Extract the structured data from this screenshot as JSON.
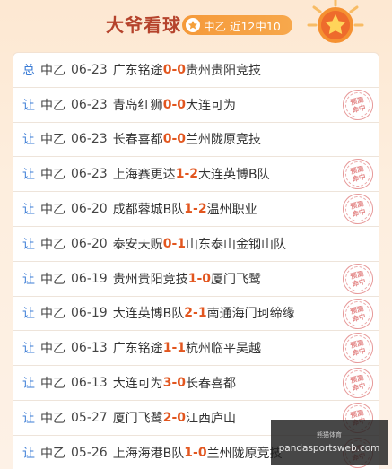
{
  "header": {
    "title": "大爷看球",
    "badge_label": "中乙 近12中10"
  },
  "rows": [
    {
      "kind": "总",
      "league": "中乙",
      "date": "06-23",
      "home": "广东铭途",
      "home_score": "0",
      "sep": " - ",
      "away_score": "0",
      "away": "贵州贵阳竞技",
      "hit": false
    },
    {
      "kind": "让",
      "league": "中乙",
      "date": "06-23",
      "home": "青岛红狮",
      "home_score": "0",
      "sep": " - ",
      "away_score": "0",
      "away": "大连可为",
      "hit": true
    },
    {
      "kind": "让",
      "league": "中乙",
      "date": "06-23",
      "home": "长春喜都",
      "home_score": "0",
      "sep": " - ",
      "away_score": "0",
      "away": "兰州陇原竞技",
      "hit": false
    },
    {
      "kind": "让",
      "league": "中乙",
      "date": "06-23",
      "home": "上海赛更达",
      "home_score": "1",
      "sep": " - ",
      "away_score": "2",
      "away": "大连英博B队",
      "hit": true
    },
    {
      "kind": "让",
      "league": "中乙",
      "date": "06-20",
      "home": "成都蓉城B队",
      "home_score": "1",
      "sep": " - ",
      "away_score": "2",
      "away": "温州职业",
      "hit": true
    },
    {
      "kind": "让",
      "league": "中乙",
      "date": "06-20",
      "home": "泰安天贶",
      "home_score": "0",
      "sep": " - ",
      "away_score": "1",
      "away": "山东泰山金钢山队",
      "hit": false
    },
    {
      "kind": "让",
      "league": "中乙",
      "date": "06-19",
      "home": "贵州贵阳竞技",
      "home_score": "1",
      "sep": " - ",
      "away_score": "0",
      "away": "厦门飞鹭",
      "hit": true
    },
    {
      "kind": "让",
      "league": "中乙",
      "date": "06-19",
      "home": "大连英博B队",
      "home_score": "2",
      "sep": " - ",
      "away_score": "1",
      "away": "南通海门珂缔缘",
      "hit": true
    },
    {
      "kind": "让",
      "league": "中乙",
      "date": "06-13",
      "home": "广东铭途",
      "home_score": "1",
      "sep": " - ",
      "away_score": "1",
      "away": "杭州临平吴越",
      "hit": true
    },
    {
      "kind": "让",
      "league": "中乙",
      "date": "06-13",
      "home": "大连可为",
      "home_score": "3",
      "sep": " - ",
      "away_score": "0",
      "away": "长春喜都",
      "hit": true
    },
    {
      "kind": "让",
      "league": "中乙",
      "date": "05-27",
      "home": "厦门飞鹭",
      "home_score": "2",
      "sep": " - ",
      "away_score": "0",
      "away": "江西庐山",
      "hit": true
    },
    {
      "kind": "让",
      "league": "中乙",
      "date": "05-26",
      "home": "上海海港B队",
      "home_score": "1",
      "sep": " - ",
      "away_score": "0",
      "away": "兰州陇原竞技",
      "hit": true
    }
  ],
  "stamp": {
    "line1": "预测",
    "line2": "命中"
  },
  "watermark": {
    "top": "熊猫体育",
    "text": "pandasportsweb.com"
  },
  "colors": {
    "accent": "#e2561f",
    "title": "#b5432c",
    "kind": "#3a7bd5",
    "badge": "#f59a3a",
    "stamp": "#e38585"
  },
  "icons": {
    "badge": "star-icon",
    "medal": "medal-star-icon",
    "stamp": "hit-stamp-icon"
  }
}
